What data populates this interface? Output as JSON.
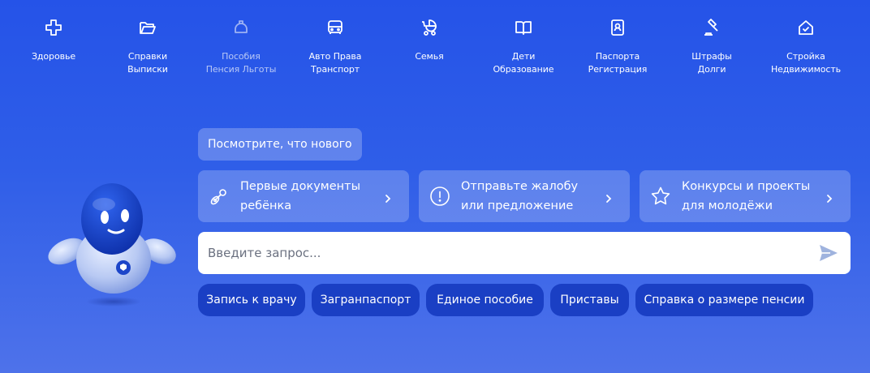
{
  "categories": [
    {
      "label": "Здоровье",
      "icon": "medical-cross-icon",
      "dim": false
    },
    {
      "label": "Справки\nВыписки",
      "icon": "folder-icon",
      "dim": false
    },
    {
      "label": "Пособия\nПенсия Льготы",
      "icon": "piggy-bank-icon",
      "dim": true
    },
    {
      "label": "Авто Права\nТранспорт",
      "icon": "car-icon",
      "dim": false
    },
    {
      "label": "Семья",
      "icon": "stroller-icon",
      "dim": false
    },
    {
      "label": "Дети\nОбразование",
      "icon": "book-icon",
      "dim": false
    },
    {
      "label": "Паспорта\nРегистрация",
      "icon": "passport-icon",
      "dim": false
    },
    {
      "label": "Штрафы\nДолги",
      "icon": "gavel-icon",
      "dim": false
    },
    {
      "label": "Стройка\nНедвижимость",
      "icon": "house-icon",
      "dim": false
    }
  ],
  "whats_new": "Посмотрите, что нового",
  "cards": [
    {
      "text": "Первые документы\nребёнка",
      "icon": "pacifier-icon"
    },
    {
      "text": "Отправьте жалобу\nили предложение",
      "icon": "exclamation-circle-icon"
    },
    {
      "text": "Конкурсы и проекты\nдля молодёжи",
      "icon": "star-icon"
    }
  ],
  "search": {
    "placeholder": "Введите запрос...",
    "send_icon": "send-icon"
  },
  "chips": [
    "Запись к врачу",
    "Загранпаспорт",
    "Единое пособие",
    "Приставы",
    "Справка о размере пенсии"
  ],
  "colors": {
    "background": "#2553e8",
    "chip": "#1a3fc4",
    "send_icon": "#9fb3de"
  }
}
